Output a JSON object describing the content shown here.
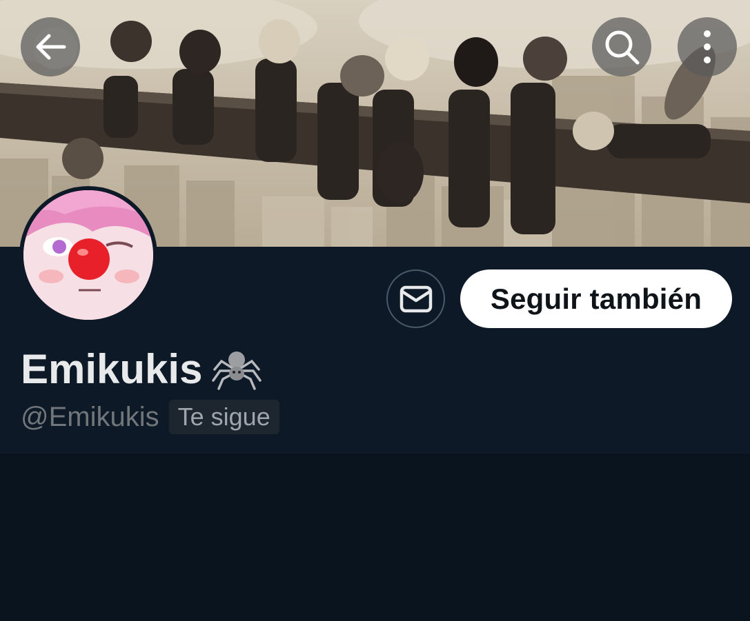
{
  "header": {
    "back_icon": "arrow-left-icon",
    "search_icon": "search-icon",
    "more_icon": "more-vertical-icon"
  },
  "profile": {
    "display_name": "Emikukis",
    "name_emoji": "spider-emoji",
    "handle": "@Emikukis",
    "follows_you_badge": "Te sigue"
  },
  "actions": {
    "message_icon": "mail-icon",
    "follow_label": "Seguir también"
  },
  "colors": {
    "background": "#0b1520",
    "profile_background": "#0d1926",
    "name_text": "#e7e9ea",
    "handle_text": "#71767b",
    "follow_button_bg": "#ffffff",
    "follow_button_text": "#0f1419"
  }
}
